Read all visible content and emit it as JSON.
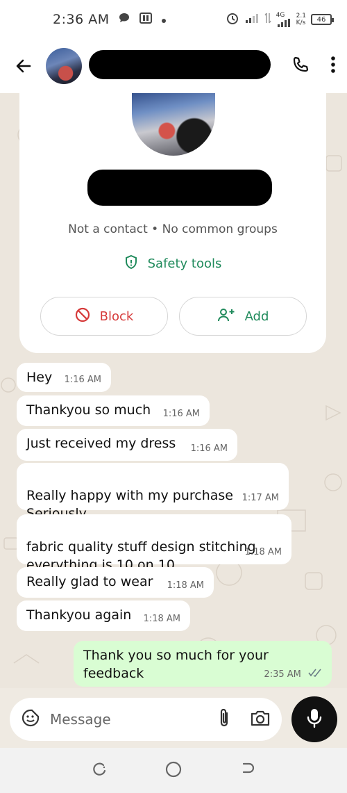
{
  "status_bar": {
    "time": "2:36 AM",
    "network_label": "4G",
    "speed_value": "2.1",
    "speed_unit": "K/s",
    "battery": "46"
  },
  "app_bar": {
    "contact_name": ""
  },
  "profile_card": {
    "contact_status": "Not a contact • No common groups",
    "safety_tools": "Safety tools",
    "block_label": "Block",
    "add_label": "Add"
  },
  "messages": [
    {
      "text": "Hey",
      "time": "1:16 AM",
      "direction": "in"
    },
    {
      "text": "Thankyou so much",
      "time": "1:16 AM",
      "direction": "in"
    },
    {
      "text": "Just received my dress",
      "time": "1:16 AM",
      "direction": "in"
    },
    {
      "text": "Really happy with my purchase\nSeriously",
      "time": "1:17 AM",
      "direction": "in"
    },
    {
      "text": "fabric quality stuff design stitching\neverything is 10 on 10",
      "time": "1:18 AM",
      "direction": "in"
    },
    {
      "text": "Really glad to wear",
      "time": "1:18 AM",
      "direction": "in"
    },
    {
      "text": "Thankyou again",
      "time": "1:18 AM",
      "direction": "in"
    },
    {
      "text": "Thank you so much for your feedback",
      "time": "2:35 AM",
      "direction": "out",
      "status": "read"
    }
  ],
  "input": {
    "placeholder": "Message"
  },
  "colors": {
    "accent_green": "#1f8a5b",
    "block_red": "#d63a3a",
    "outgoing_bubble": "#d9fdd3",
    "chat_background": "#ece6dd"
  }
}
